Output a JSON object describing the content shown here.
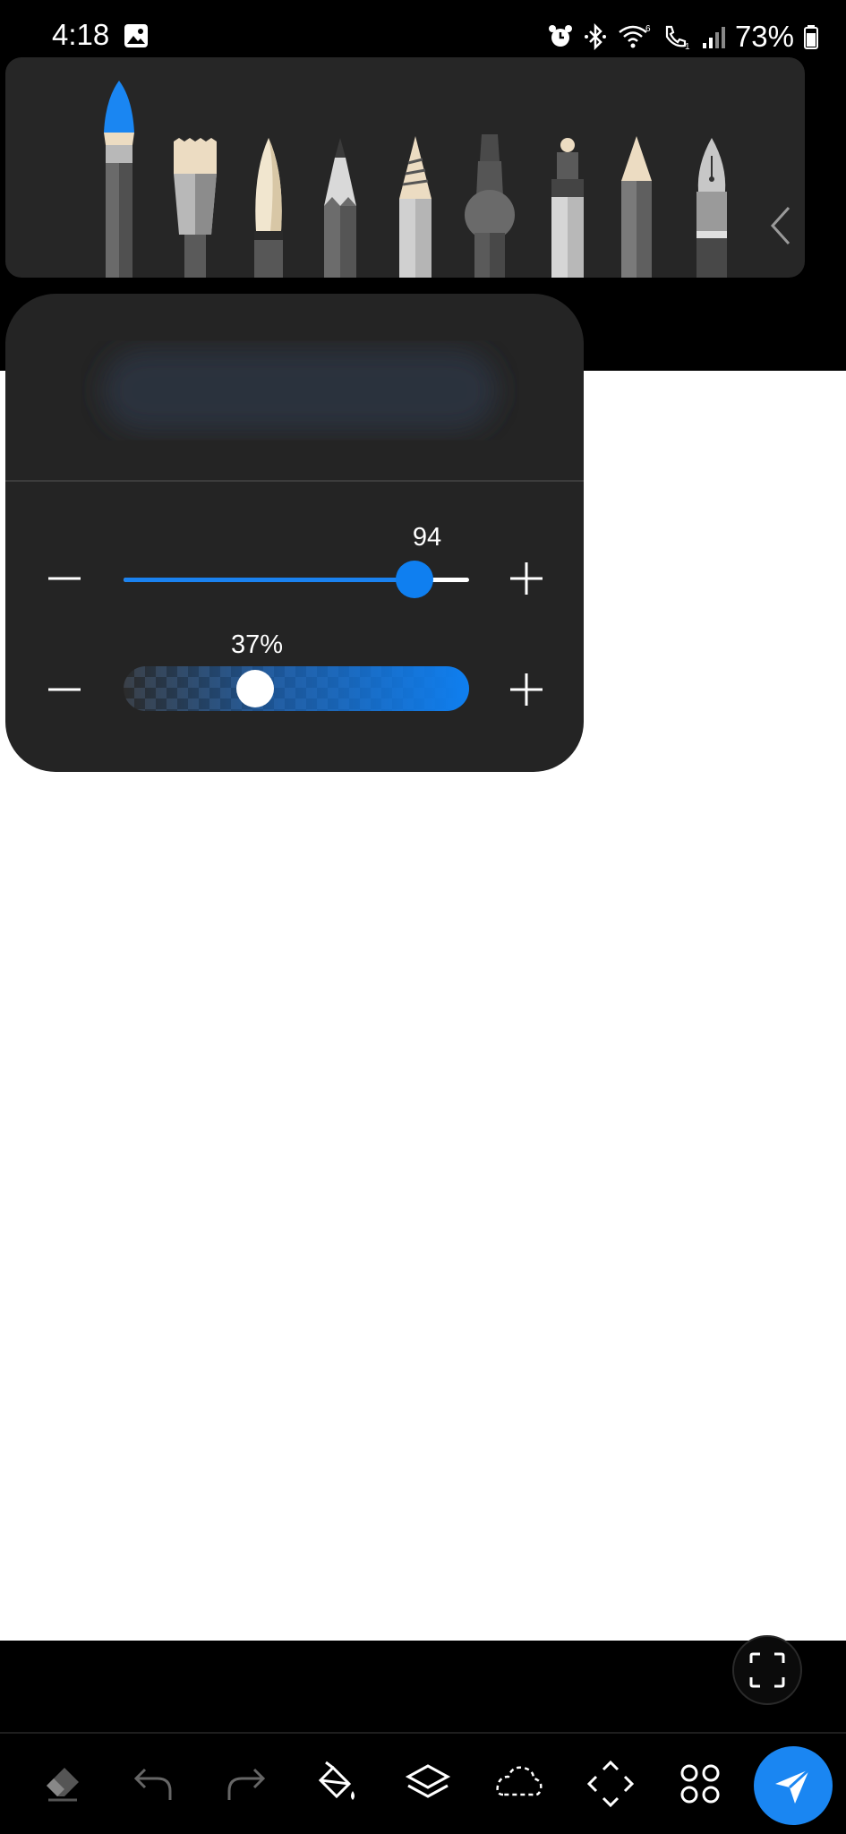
{
  "status_bar": {
    "time": "4:18",
    "battery": "73%",
    "icons": [
      "gallery-icon",
      "alarm-icon",
      "bluetooth-icon",
      "wifi-icon",
      "call-icon",
      "signal-icon",
      "battery-icon"
    ]
  },
  "brush_tray": {
    "brushes": [
      {
        "name": "watercolor-brush",
        "selected": true
      },
      {
        "name": "flat-brush",
        "selected": false
      },
      {
        "name": "round-brush",
        "selected": false
      },
      {
        "name": "pencil",
        "selected": false
      },
      {
        "name": "colored-pencil",
        "selected": false
      },
      {
        "name": "airbrush",
        "selected": false
      },
      {
        "name": "marker",
        "selected": false
      },
      {
        "name": "crayon",
        "selected": false
      },
      {
        "name": "fountain-pen",
        "selected": false
      }
    ]
  },
  "brush_settings": {
    "size": {
      "value": "94",
      "fraction": 0.89
    },
    "opacity": {
      "value": "37%",
      "fraction": 0.37
    }
  },
  "toolbar": {
    "items": [
      "eraser-icon",
      "undo-icon",
      "redo-icon",
      "fill-bucket-icon",
      "layers-icon",
      "lasso-icon",
      "transform-icon",
      "more-icon",
      "send-icon"
    ]
  },
  "colors": {
    "accent": "#1a86f2",
    "panel": "#242424",
    "tray": "#262626"
  }
}
